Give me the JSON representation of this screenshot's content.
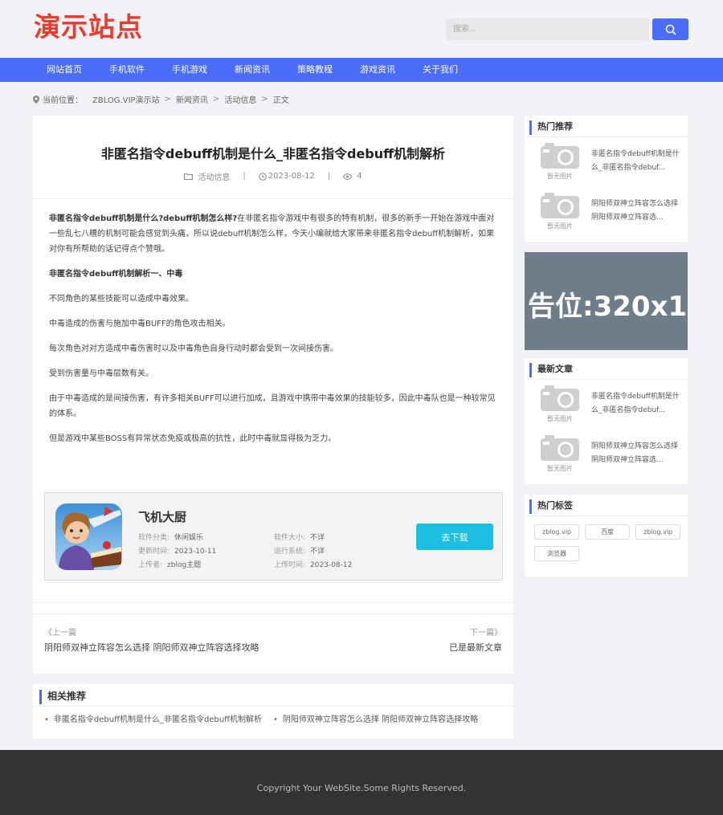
{
  "site": {
    "logo": "演示站点"
  },
  "search": {
    "placeholder": "搜索..."
  },
  "nav": {
    "items": [
      "网站首页",
      "手机软件",
      "手机游戏",
      "新闻资讯",
      "策略教程",
      "游戏资讯",
      "关于我们"
    ]
  },
  "breadcrumb": {
    "label": "当前位置：",
    "items": [
      "ZBLOG.VIP演示站",
      "新闻资讯",
      "活动信息",
      "正文"
    ]
  },
  "article": {
    "title": "非匿名指令debuff机制是什么_非匿名指令debuff机制解析",
    "category": "活动信息",
    "date": "2023-08-12",
    "views": "4",
    "lead_bold": "非匿名指令debuff机制是什么?debuff机制怎么样?",
    "lead_rest": "在非匿名指令游戏中有很多的特有机制，很多的新手一开始在游戏中面对一些乱七八糟的机制可能会感觉到头痛，所以说debuff机制怎么样，今天小编就给大家带来非匿名指令debuff机制解析，如果对你有所帮助的话记得点个赞哦。",
    "subheading": "非匿名指令debuff机制解析一、中毒",
    "paragraphs": [
      "不同角色的某些技能可以造成中毒效果。",
      "中毒造成的伤害与施加中毒BUFF的角色攻击相关。",
      "每次角色对对方造成中毒伤害时以及中毒角色自身行动时都会受到一次间接伤害。",
      "受到伤害量与中毒层数有关。",
      "由于中毒造成的是间接伤害，有许多相关BUFF可以进行加成，且游戏中携带中毒效果的技能较多，因此中毒队也是一种较常见的体系。",
      "但是游戏中某些BOSS有异常状态免疫或极高的抗性，此时中毒就显得极为乏力。"
    ]
  },
  "app": {
    "name": "飞机大厨",
    "category_label": "软件分类:",
    "category": "休闲娱乐",
    "size_label": "软件大小:",
    "size": "不详",
    "updated_label": "更新时间:",
    "updated": "2023-10-11",
    "os_label": "运行系统:",
    "os": "不详",
    "uploader_label": "上传者:",
    "uploader": "zblog主题",
    "uploaded_label": "上传时间:",
    "uploaded": "2023-08-12",
    "download_label": "去下载"
  },
  "pager": {
    "prev_label": "《上一篇",
    "prev_title": "阴阳师双神立阵容怎么选择 阴阳师双神立阵容选择攻略",
    "next_label": "下一篇》",
    "next_title": "已是最新文章"
  },
  "related": {
    "title": "相关推荐",
    "items": [
      "非匿名指令debuff机制是什么_非匿名指令debuff机制解析",
      "阴阳师双神立阵容怎么选择 阴阳师双神立阵容选择攻略"
    ]
  },
  "sidebar": {
    "hot_title": "热门推荐",
    "hot_items": [
      "非匿名指令debuff机制是什么_非匿名指令debuf...",
      "阴阳师双神立阵容怎么选择 阴阳师双神立阵容选..."
    ],
    "no_image": "暂无图片",
    "ad_text": "告位:320x1",
    "latest_title": "最新文章",
    "latest_items": [
      "非匿名指令debuff机制是什么_非匿名指令debuf...",
      "阴阳师双神立阵容怎么选择 阴阳师双神立阵容选..."
    ],
    "tags_title": "热门标签",
    "tags": [
      "zblog.vip",
      "百度",
      "zblog.vip",
      "浏览器"
    ]
  },
  "footer": {
    "copyright": "Copyright Your WebSite.Some Rights Reserved."
  },
  "colors": {
    "brand_blue": "#4a6cf7",
    "logo_red": "#f03a2e",
    "download_cyan": "#1dbee0",
    "footer_bg": "#333333"
  }
}
